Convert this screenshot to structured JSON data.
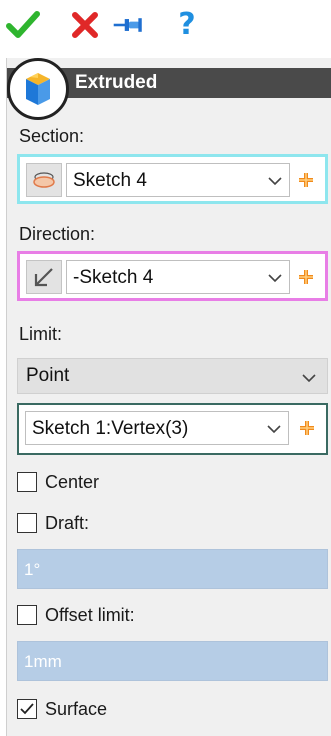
{
  "toolbar": {
    "ok_icon": "checkmark-icon",
    "cancel_icon": "close-icon",
    "pin_icon": "pushpin-icon",
    "help_label": "?"
  },
  "panel": {
    "title": "Extruded",
    "feature_icon": "extrude-feature-icon"
  },
  "section": {
    "label": "Section:",
    "value": "Sketch 4",
    "icon": "sketch-profile-icon"
  },
  "direction": {
    "label": "Direction:",
    "value": "-Sketch 4",
    "icon": "direction-arrow-icon"
  },
  "limit": {
    "label": "Limit:",
    "type_value": "Point",
    "reference_value": "Sketch 1:Vertex(3)"
  },
  "options": {
    "center_label": "Center",
    "center_checked": false,
    "draft_label": "Draft:",
    "draft_checked": false,
    "draft_value": "1°",
    "offset_label": "Offset limit:",
    "offset_checked": false,
    "offset_value": "1mm",
    "surface_label": "Surface",
    "surface_checked": true
  },
  "colors": {
    "section_border": "#8ee6ee",
    "direction_border": "#e87ee6",
    "vertex_border": "#3a6a62",
    "header_bg": "#4a4a4a",
    "disabled_input_bg": "#b6cde6",
    "plus_color": "#f08a1c"
  }
}
